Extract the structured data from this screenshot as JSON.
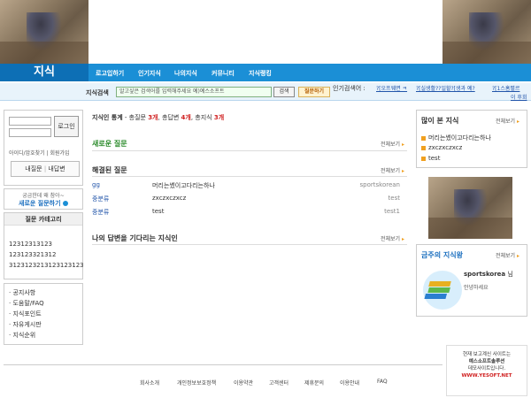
{
  "header": {
    "brand": "지식",
    "nav": [
      "로고입하기",
      "인기지식",
      "나의지식",
      "커뮤니티",
      "지식랭킹"
    ]
  },
  "search": {
    "label": "지식검색",
    "value": "알고싶은 검색어를 입력해주세요 예)예스소프트",
    "button": "검색",
    "ask_button": "질문하기",
    "popular_label": "인기검색어 :",
    "popular_terms": [
      "?[오프웨면 ㅋ",
      "?[실생활??일할?[생과 예?",
      "?[1스홈펼르",
      "이 후회"
    ]
  },
  "login": {
    "button": "로그인",
    "find_link": "아이디/암호찾기 | 회원가입",
    "my_question": "내질문",
    "my_answer": "내답변"
  },
  "ask_promo": {
    "line1": "궁금한데 왜 참아~",
    "line2": "새로운 질문하기"
  },
  "categories": {
    "title": "질문 카테고리",
    "items": [
      "12312313123",
      "123123321312",
      "3123123213123123123"
    ]
  },
  "menu": [
    "공지사항",
    "도움말/FAQ",
    "지식포인트",
    "자유게시판",
    "지식순위"
  ],
  "stats": {
    "label": "지식인 통계",
    "questions_label": "총질문",
    "questions": "3개",
    "answers_label": "총답변",
    "answers": "4개",
    "knowledge_label": "총지식",
    "knowledge": "3개"
  },
  "sections": {
    "new_questions": "새로운 질문",
    "solved_questions": "해결된 질문",
    "waiting_answers": "나의 답변을 기다리는 지식인",
    "more": "전체보기"
  },
  "solved": [
    {
      "category": "gg",
      "title": "머리는쎘이고다리는하나",
      "author": "sportskorean"
    },
    {
      "category": "중분류",
      "title": "zxczxczxcz",
      "author": "test"
    },
    {
      "category": "중분류",
      "title": "test",
      "author": "test1"
    }
  ],
  "popular": {
    "title": "많이 본 지식",
    "more": "전체보기",
    "items": [
      "머리는쎘이고다리는하나",
      "zxczxczxcz",
      "test"
    ]
  },
  "weekly": {
    "title": "금주의 지식왕",
    "more": "전체보기",
    "user": "sportskorea",
    "honorific": "님",
    "greeting": "안녕하세요"
  },
  "footer": {
    "links": [
      "회사소개",
      "개인정보보호정책",
      "이용약관",
      "고객센터",
      "제휴문의",
      "이용안내",
      "FAQ"
    ]
  },
  "ad": {
    "line1": "현재 보고계신 사이트는",
    "line2": "예스소프트솔루션",
    "line3": "데모사이트입니다.",
    "url": "WWW.YESOFT.NET"
  },
  "colors": {
    "nav_bg": "#1b8fd6",
    "accent_red": "#d02020",
    "link_blue": "#2255aa"
  }
}
